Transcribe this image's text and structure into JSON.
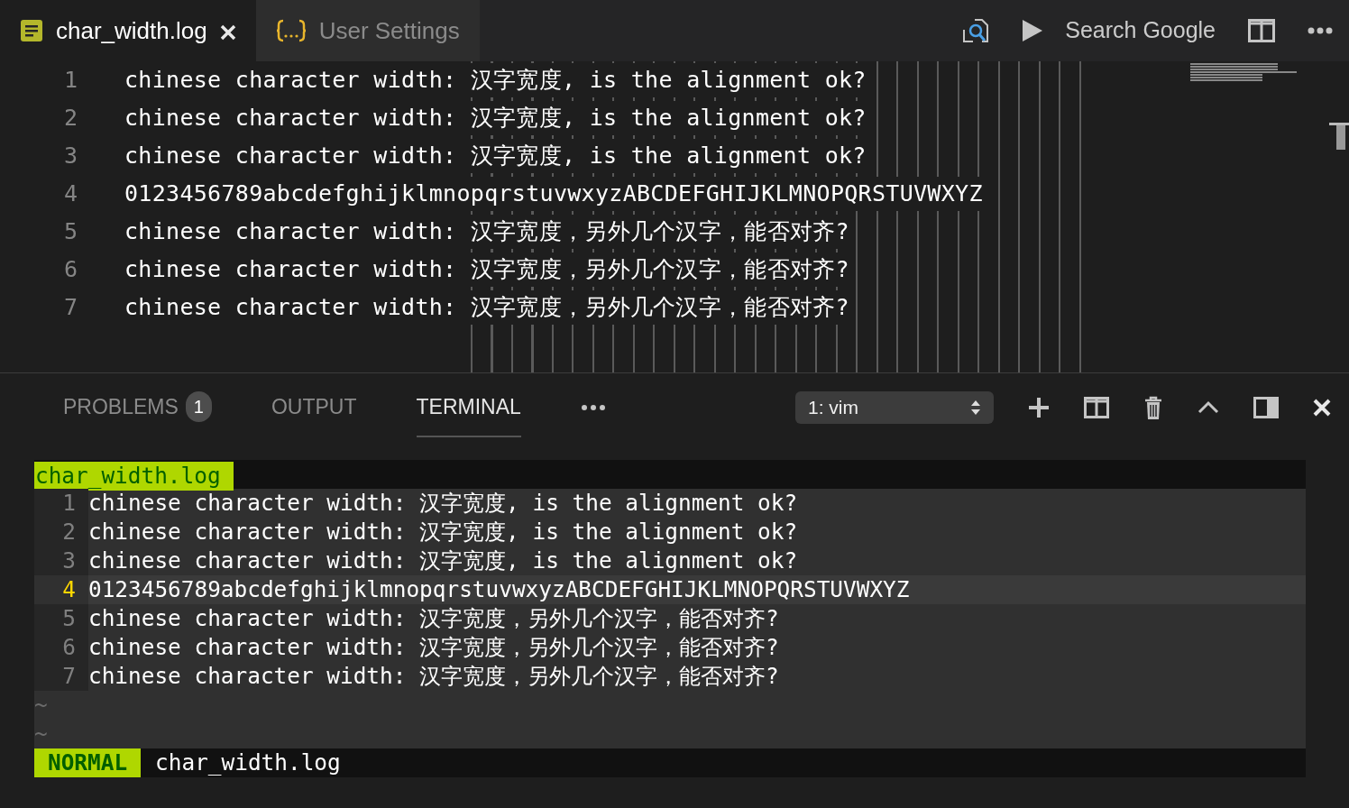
{
  "tabs": [
    {
      "label": "char_width.log",
      "kind": "log",
      "selected": true,
      "closable": true
    },
    {
      "label": "User Settings",
      "kind": "settings",
      "selected": false,
      "closable": false
    }
  ],
  "toolbar": {
    "search_label": "Search Google"
  },
  "editor": {
    "lines": [
      {
        "number": "1",
        "text": "chinese character width: 汉字宽度, is the alignment ok?"
      },
      {
        "number": "2",
        "text": "chinese character width: 汉字宽度, is the alignment ok?"
      },
      {
        "number": "3",
        "text": "chinese character width: 汉字宽度, is the alignment ok?"
      },
      {
        "number": "4",
        "text": "0123456789abcdefghijklmnopqrstuvwxyzABCDEFGHIJKLMNOPQRSTUVWXYZ"
      },
      {
        "number": "5",
        "text": "chinese character width: 汉字宽度，另外几个汉字，能否对齐?"
      },
      {
        "number": "6",
        "text": "chinese character width: 汉字宽度，另外几个汉字，能否对齐?"
      },
      {
        "number": "7",
        "text": "chinese character width: 汉字宽度，另外几个汉字，能否对齐?"
      }
    ]
  },
  "panel": {
    "tabs": [
      {
        "label": "PROBLEMS",
        "badge": "1",
        "selected": false
      },
      {
        "label": "OUTPUT",
        "selected": false
      },
      {
        "label": "TERMINAL",
        "selected": true
      }
    ],
    "terminal_select": "1: vim"
  },
  "terminal": {
    "file_tab": "char_width.log",
    "lines": [
      {
        "number": "1",
        "text": "chinese character width: 汉字宽度, is the alignment ok?",
        "current": false
      },
      {
        "number": "2",
        "text": "chinese character width: 汉字宽度, is the alignment ok?",
        "current": false
      },
      {
        "number": "3",
        "text": "chinese character width: 汉字宽度, is the alignment ok?",
        "current": false
      },
      {
        "number": "4",
        "text": "0123456789abcdefghijklmnopqrstuvwxyzABCDEFGHIJKLMNOPQRSTUVWXYZ",
        "current": true
      },
      {
        "number": "5",
        "text": "chinese character width: 汉字宽度，另外几个汉字，能否对齐?",
        "current": false
      },
      {
        "number": "6",
        "text": "chinese character width: 汉字宽度，另外几个汉字，能否对齐?",
        "current": false
      },
      {
        "number": "7",
        "text": "chinese character width: 汉字宽度，另外几个汉字，能否对齐?",
        "current": false
      }
    ],
    "tildes": [
      "~",
      "~"
    ],
    "mode": "NORMAL",
    "status_file": "char_width.log"
  }
}
